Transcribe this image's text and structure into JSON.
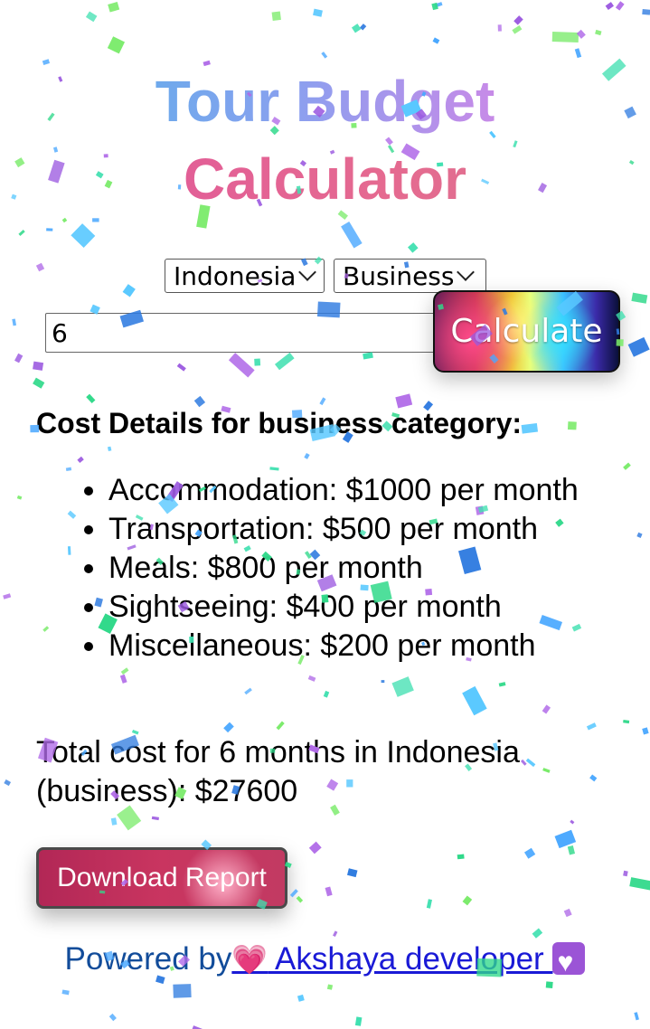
{
  "title": {
    "line1": "Tour Budget",
    "line2": "Calculator"
  },
  "form": {
    "country_selected": "Indonesia",
    "category_selected": "Business",
    "months_value": "6",
    "calculate_label": "Calculate"
  },
  "details": {
    "heading": "Cost Details for business category:",
    "items": [
      "Accommodation: $1000 per month",
      "Transportation: $500 per month",
      "Meals: $800 per month",
      "Sightseeing: $400 per month",
      "Miscellaneous: $200 per month"
    ],
    "total": "Total cost for 6 months in Indonesia (business): $27600"
  },
  "download_label": "Download Report",
  "footer": {
    "prefix": "Powered by",
    "link_text": " Akshaya developer "
  },
  "icons": {
    "pink_heart": "sparkling-heart-icon",
    "purple_heart": "white-heart-icon",
    "dropdown": "chevron-down-icon"
  },
  "colors": {
    "title_gradient_start": "#4fb4e8",
    "title_gradient_end": "#e07ac6",
    "calculator_color": "#e0559c",
    "footer_text": "#124c9a",
    "link": "#1a1ad6",
    "download_button": "#c23a62"
  }
}
